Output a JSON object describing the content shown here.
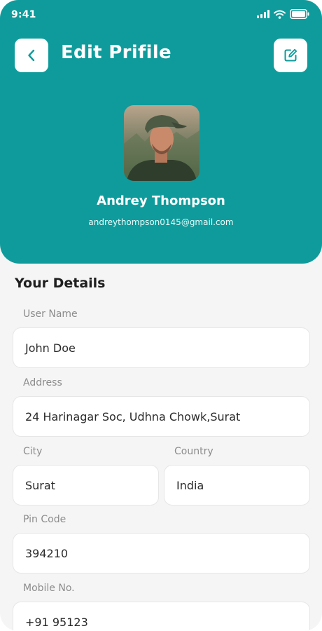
{
  "status_bar": {
    "time": "9:41"
  },
  "header": {
    "title": "Edit Prifile",
    "back_icon": "chevron-left-icon",
    "edit_icon": "edit-square-icon"
  },
  "profile": {
    "name": "Andrey Thompson",
    "email": "andreythompson0145@gmail.com"
  },
  "details": {
    "section_title": "Your Details",
    "user_name": {
      "label": "User Name",
      "value": "John Doe"
    },
    "address": {
      "label": "Address",
      "value": "24 Harinagar Soc, Udhna Chowk,Surat"
    },
    "city": {
      "label": "City",
      "value": "Surat"
    },
    "country": {
      "label": "Country",
      "value": "India"
    },
    "pin_code": {
      "label": "Pin Code",
      "value": "394210"
    },
    "mobile": {
      "label": "Mobile No.",
      "value": "+91 95123"
    }
  },
  "colors": {
    "primary": "#0f9b9b",
    "background": "#f5f5f5",
    "field_background": "#ffffff"
  }
}
